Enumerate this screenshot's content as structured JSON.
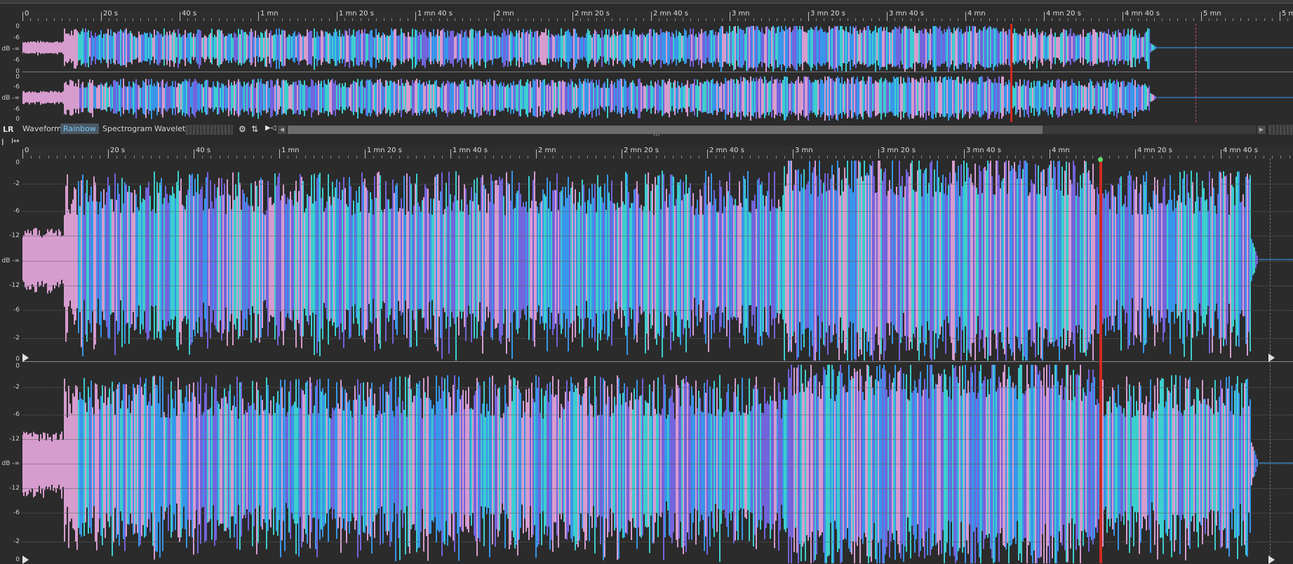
{
  "overview": {
    "ruler_labels": [
      "0",
      "20 s",
      "40 s",
      "1 mn",
      "1 mn 20 s",
      "1 mn 40 s",
      "2 mn",
      "2 mn 20 s",
      "2 mn 40 s",
      "3 mn",
      "3 mn 20 s",
      "3 mn 40 s",
      "4 mn",
      "4 mn 20 s",
      "4 mn 40 s",
      "5 mn",
      "5 mn"
    ],
    "db_labels": [
      "0",
      "-6",
      "dB -∞",
      "-6",
      "0"
    ],
    "cursor_time": "3 mn 55 s"
  },
  "mode_bar": {
    "channels_label": "LR",
    "modes": [
      "Waveform",
      "Rainbow",
      "Spectrogram",
      "Wavelet"
    ],
    "active_mode": "Rainbow",
    "divider_handle": "...",
    "icons": [
      "gear-icon",
      "swap-icon",
      "speaker-icon"
    ]
  },
  "detail": {
    "ruler_labels": [
      "0",
      "20 s",
      "40 s",
      "1 mn",
      "1 mn 20 s",
      "1 mn 40 s",
      "2 mn",
      "2 mn 20 s",
      "2 mn 40 s",
      "3 mn",
      "3 mn 20 s",
      "3 mn 40 s",
      "4 mn",
      "4 mn 20 s",
      "4 mn 40 s"
    ],
    "db_labels_top": [
      "0",
      "-2",
      "-6",
      "-12",
      "dB -∞",
      "-12",
      "-6",
      "-2",
      "0"
    ],
    "db_labels_bottom": [
      "0",
      "-2",
      "-6",
      "-12",
      "dB -∞",
      "-12",
      "-6",
      "-2",
      "0"
    ]
  },
  "colors": {
    "background": "#2b2b2b",
    "cursor": "#d12a22",
    "wave_blue": "#3aa2ff",
    "wave_cyan": "#3fe0e0",
    "wave_pink": "#e9a9e0",
    "wave_violet": "#7b6bf0",
    "playhead_marker": "#5be36a"
  }
}
